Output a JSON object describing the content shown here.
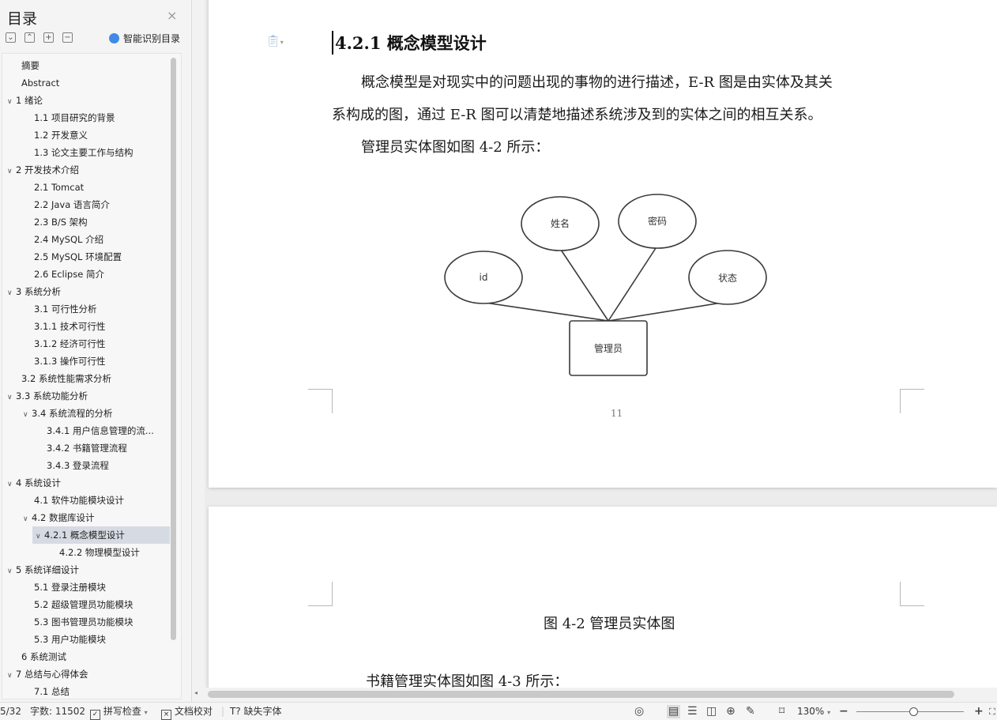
{
  "sidebar": {
    "title": "目录",
    "close_glyph": "×",
    "toolbar": [
      {
        "name": "collapse-all-icon",
        "glyph": "⌄"
      },
      {
        "name": "expand-all-icon",
        "glyph": "⌃"
      },
      {
        "name": "add-level-icon",
        "glyph": "+"
      },
      {
        "name": "remove-level-icon",
        "glyph": "−"
      }
    ],
    "smart_toc_label": "智能识别目录",
    "toc_items": [
      {
        "label": "摘要",
        "level": 1,
        "arrow": false
      },
      {
        "label": "Abstract",
        "level": 1,
        "arrow": false
      },
      {
        "label": "1 绪论",
        "level": 0,
        "arrow": true
      },
      {
        "label": "1.1 项目研究的背景",
        "level": 2,
        "arrow": false
      },
      {
        "label": "1.2 开发意义",
        "level": 2,
        "arrow": false
      },
      {
        "label": "1.3 论文主要工作与结构",
        "level": 2,
        "arrow": false
      },
      {
        "label": "2 开发技术介绍",
        "level": 0,
        "arrow": true
      },
      {
        "label": "2.1 Tomcat",
        "level": 2,
        "arrow": false
      },
      {
        "label": "2.2 Java 语言简介",
        "level": 2,
        "arrow": false
      },
      {
        "label": "2.3 B/S 架构",
        "level": 2,
        "arrow": false
      },
      {
        "label": "2.4 MySQL 介绍",
        "level": 2,
        "arrow": false
      },
      {
        "label": "2.5 MySQL 环境配置",
        "level": 2,
        "arrow": false
      },
      {
        "label": "2.6 Eclipse 简介",
        "level": 2,
        "arrow": false
      },
      {
        "label": "3 系统分析",
        "level": 0,
        "arrow": true
      },
      {
        "label": "3.1 可行性分析",
        "level": 2,
        "arrow": false
      },
      {
        "label": "3.1.1 技术可行性",
        "level": 2,
        "arrow": false
      },
      {
        "label": "3.1.2 经济可行性",
        "level": 2,
        "arrow": false
      },
      {
        "label": "3.1.3 操作可行性",
        "level": 2,
        "arrow": false
      },
      {
        "label": "3.2 系统性能需求分析",
        "level": 1,
        "arrow": false
      },
      {
        "label": "3.3 系统功能分析",
        "level": 0,
        "arrow": true
      },
      {
        "label": "3.4 系统流程的分析",
        "level": 1.5,
        "arrow": true
      },
      {
        "label": "3.4.1 用户信息管理的流...",
        "level": 3,
        "arrow": false
      },
      {
        "label": "3.4.2 书籍管理流程",
        "level": 3,
        "arrow": false
      },
      {
        "label": "3.4.3 登录流程",
        "level": 3,
        "arrow": false
      },
      {
        "label": "4 系统设计",
        "level": 0,
        "arrow": true
      },
      {
        "label": "4.1 软件功能模块设计",
        "level": 2,
        "arrow": false
      },
      {
        "label": "4.2 数据库设计",
        "level": 1.5,
        "arrow": true
      },
      {
        "label": "4.2.1 概念模型设计",
        "level": 2.5,
        "arrow": true,
        "selected": true
      },
      {
        "label": "4.2.2 物理模型设计",
        "level": 4,
        "arrow": false
      },
      {
        "label": "5 系统详细设计",
        "level": 0,
        "arrow": true
      },
      {
        "label": "5.1 登录注册模块",
        "level": 2,
        "arrow": false
      },
      {
        "label": "5.2 超级管理员功能模块",
        "level": 2,
        "arrow": false
      },
      {
        "label": "5.3 图书管理员功能模块",
        "level": 2,
        "arrow": false
      },
      {
        "label": "5.3 用户功能模块",
        "level": 2,
        "arrow": false
      },
      {
        "label": "6 系统测试",
        "level": 1,
        "arrow": false
      },
      {
        "label": "7 总结与心得体会",
        "level": 0,
        "arrow": true
      },
      {
        "label": "7.1 总结",
        "level": 2,
        "arrow": false
      }
    ]
  },
  "document": {
    "heading": "4.2.1 概念模型设计",
    "para1_line1": "概念模型是对现实中的问题出现的事物的进行描述，E-R 图是由实体及其关",
    "para1_line2": "系构成的图，通过 E-R 图可以清楚地描述系统涉及到的实体之间的相互关系。",
    "para2": "管理员实体图如图 4-2 所示：",
    "page_number": "11",
    "caption": "图 4-2 管理员实体图",
    "para3": "书籍管理实体图如图 4-3 所示：",
    "diagram": {
      "entity": "管理员",
      "attributes": [
        "id",
        "姓名",
        "密码",
        "状态"
      ]
    }
  },
  "statusbar": {
    "page": "5/32",
    "word_count": "字数: 11502",
    "spell_check": "拼写检查",
    "doc_proof": "文档校对",
    "missing_font": "缺失字体",
    "zoom": "130%"
  }
}
